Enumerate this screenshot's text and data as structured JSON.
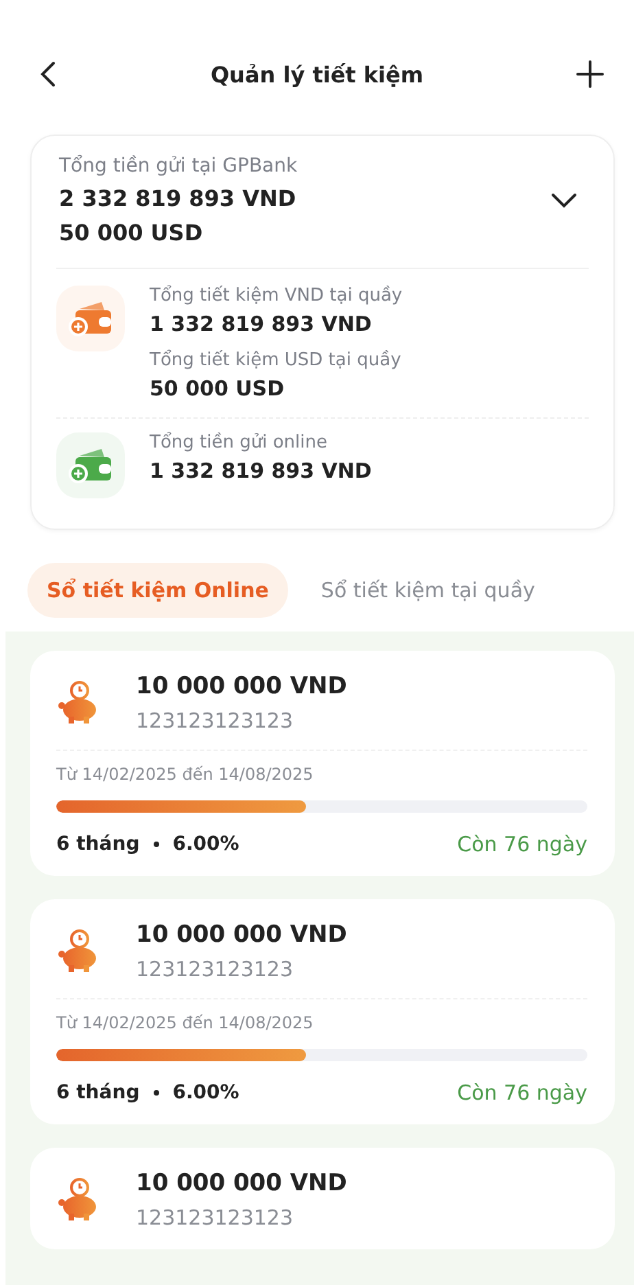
{
  "header": {
    "title": "Quản lý tiết kiệm"
  },
  "summary": {
    "label": "Tổng tiền gửi tại GPBank",
    "amounts": [
      "2 332 819 893 VND",
      "50 000 USD"
    ],
    "expanded": true,
    "groups": [
      {
        "color": "#ee7a30",
        "items": [
          {
            "label": "Tổng tiết kiệm VND tại quầy",
            "value": "1 332 819 893 VND"
          },
          {
            "label": "Tổng tiết kiệm USD tại quầy",
            "value": "50 000 USD"
          }
        ]
      },
      {
        "color": "#4caa4a",
        "items": [
          {
            "label": "Tổng tiền gửi online",
            "value": "1 332 819 893 VND"
          }
        ]
      }
    ]
  },
  "tabs": [
    {
      "label": "Sổ tiết kiệm Online",
      "selected": true
    },
    {
      "label": "Sổ tiết kiệm tại quầy",
      "selected": false
    }
  ],
  "accounts": [
    {
      "amount": "10 000 000 VND",
      "number": "123123123123",
      "period": "Từ 14/02/2025 đến 14/08/2025",
      "level": 0.47,
      "term": "6 tháng",
      "rate": "6.00%",
      "remaining": "Còn 76 ngày"
    },
    {
      "amount": "10 000 000 VND",
      "number": "123123123123",
      "period": "Từ 14/02/2025 đến 14/08/2025",
      "level": 0.47,
      "term": "6 tháng",
      "rate": "6.00%",
      "remaining": "Còn 76 ngày"
    },
    {
      "amount": "10 000 000 VND",
      "number": "123123123123"
    }
  ]
}
